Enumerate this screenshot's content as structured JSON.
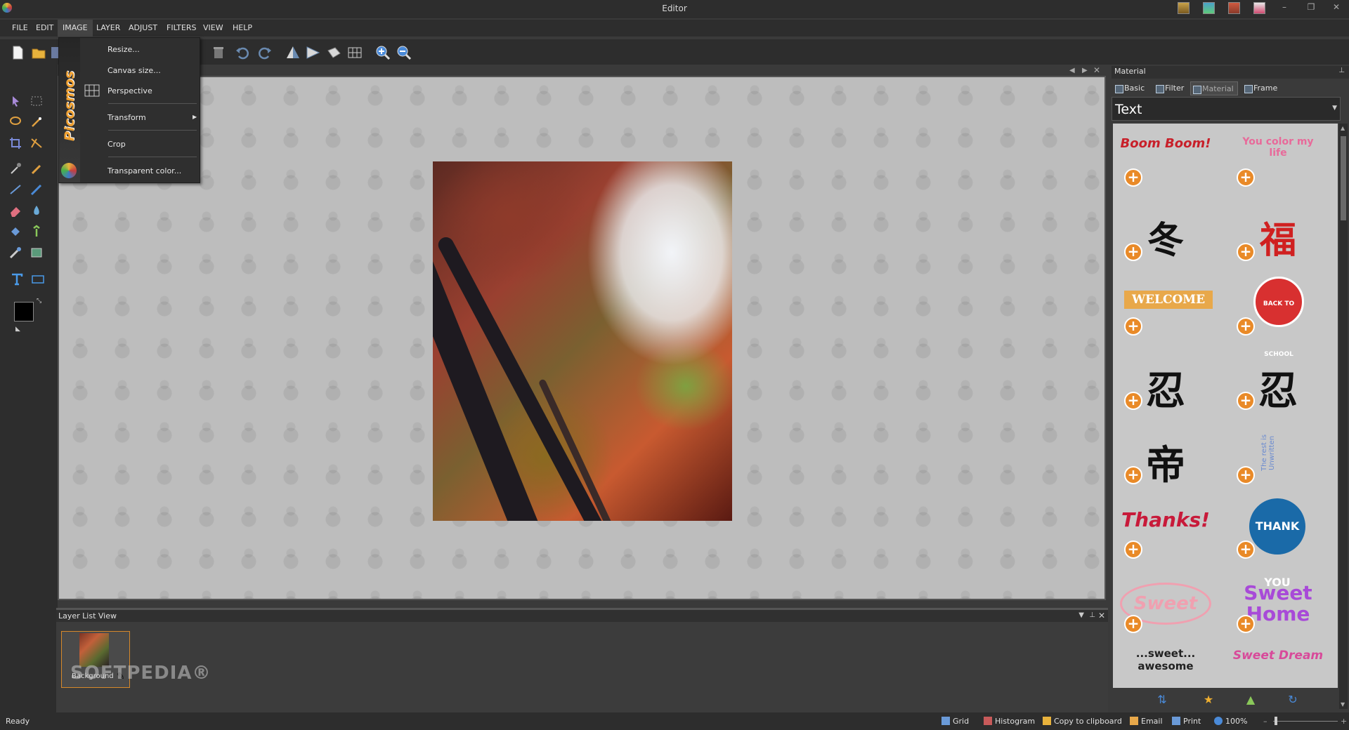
{
  "window": {
    "title": "Editor"
  },
  "menubar": {
    "items": [
      "FILE",
      "EDIT",
      "IMAGE",
      "LAYER",
      "ADJUST",
      "FILTERS",
      "VIEW",
      "HELP"
    ]
  },
  "image_menu": {
    "brand": "Picosmos",
    "items": [
      "Resize...",
      "Canvas size...",
      "Perspective",
      "Transform",
      "Crop",
      "Transparent color..."
    ]
  },
  "layer_panel": {
    "title": "Layer List View",
    "layer_name": "Background"
  },
  "watermark": "SOFTPEDIA®",
  "material_panel": {
    "title": "Material",
    "tabs": [
      "Basic",
      "Filter",
      "Material",
      "Frame"
    ],
    "active_tab": "Material",
    "category": "Text",
    "items": [
      {
        "art": "Boom Boom!"
      },
      {
        "art": "You color my life"
      },
      {
        "art": "冬"
      },
      {
        "art": "福"
      },
      {
        "art": "WELCOME"
      },
      {
        "art": "BACK TO SCHOOL"
      },
      {
        "art": "忍"
      },
      {
        "art": "忍"
      },
      {
        "art": "帝"
      },
      {
        "art": "The rest is Unwritten"
      },
      {
        "art": "Thanks!"
      },
      {
        "art": "THANK YOU"
      },
      {
        "art": "Sweet"
      },
      {
        "art": "Sweet Home"
      },
      {
        "art": "...sweet... awesome"
      },
      {
        "art": "Sweet Dream"
      }
    ]
  },
  "statusbar": {
    "status": "Ready",
    "grid": "Grid",
    "histogram": "Histogram",
    "copy": "Copy to clipboard",
    "email": "Email",
    "print": "Print",
    "zoom": "100%"
  },
  "colors": {
    "accent": "#e98a28",
    "background": "#2d2d2d",
    "brand": "#f0a030"
  }
}
